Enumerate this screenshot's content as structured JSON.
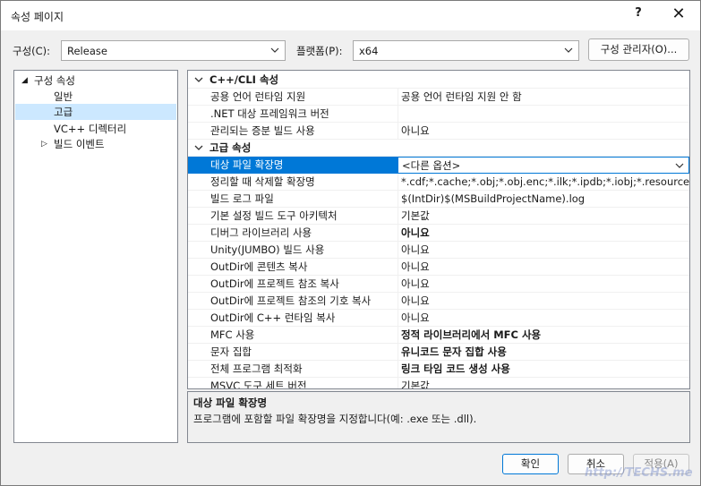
{
  "window": {
    "title": "속성 페이지",
    "help": "?",
    "close": "✕"
  },
  "toolbar": {
    "config_label": "구성(C):",
    "config_value": "Release",
    "platform_label": "플랫폼(P):",
    "platform_value": "x64",
    "config_manager": "구성 관리자(O)..."
  },
  "tree": {
    "root": "구성 속성",
    "items": [
      "일반",
      "고급",
      "VC++ 디렉터리",
      "빌드 이벤트"
    ]
  },
  "grid": {
    "categories": [
      {
        "title": "C++/CLI 속성",
        "rows": [
          {
            "name": "공용 언어 런타임 지원",
            "value": "공용 언어 런타임 지원 안 함",
            "bold": false
          },
          {
            "name": ".NET 대상 프레임워크 버전",
            "value": "",
            "bold": false
          },
          {
            "name": "관리되는 증분 빌드 사용",
            "value": "아니요",
            "bold": false
          }
        ]
      },
      {
        "title": "고급 속성",
        "rows": [
          {
            "name": "대상 파일 확장명",
            "value": "<다른 옵션>",
            "bold": false
          },
          {
            "name": "정리할 때 삭제할 확장명",
            "value": "*.cdf;*.cache;*.obj;*.obj.enc;*.ilk;*.ipdb;*.iobj;*.resources;*.t",
            "bold": false
          },
          {
            "name": "빌드 로그 파일",
            "value": "$(IntDir)$(MSBuildProjectName).log",
            "bold": false
          },
          {
            "name": "기본 설정 빌드 도구 아키텍처",
            "value": "기본값",
            "bold": false
          },
          {
            "name": "디버그 라이브러리 사용",
            "value": "아니요",
            "bold": true
          },
          {
            "name": "Unity(JUMBO) 빌드 사용",
            "value": "아니요",
            "bold": false
          },
          {
            "name": "OutDir에 콘텐츠 복사",
            "value": "아니요",
            "bold": false
          },
          {
            "name": "OutDir에 프로젝트 참조 복사",
            "value": "아니요",
            "bold": false
          },
          {
            "name": "OutDir에 프로젝트 참조의 기호 복사",
            "value": "아니요",
            "bold": false
          },
          {
            "name": "OutDir에 C++ 런타임 복사",
            "value": "아니요",
            "bold": false
          },
          {
            "name": "MFC 사용",
            "value": "정적 라이브러리에서 MFC 사용",
            "bold": true
          },
          {
            "name": "문자 집합",
            "value": "유니코드 문자 집합 사용",
            "bold": true
          },
          {
            "name": "전체 프로그램 최적화",
            "value": "링크 타임 코드 생성 사용",
            "bold": true
          },
          {
            "name": "MSVC 도구 세트 버전",
            "value": "기본값",
            "bold": false
          }
        ]
      }
    ]
  },
  "description": {
    "title": "대상 파일 확장명",
    "text": "프로그램에 포함할 파일 확장명을 지정합니다(예: .exe 또는 .dll)."
  },
  "buttons": {
    "ok": "확인",
    "cancel": "취소",
    "apply": "적용(A)"
  },
  "watermark": "http://TECHS.me",
  "colors": {
    "selection": "#0078d7",
    "tree_selection": "#cce8ff"
  }
}
